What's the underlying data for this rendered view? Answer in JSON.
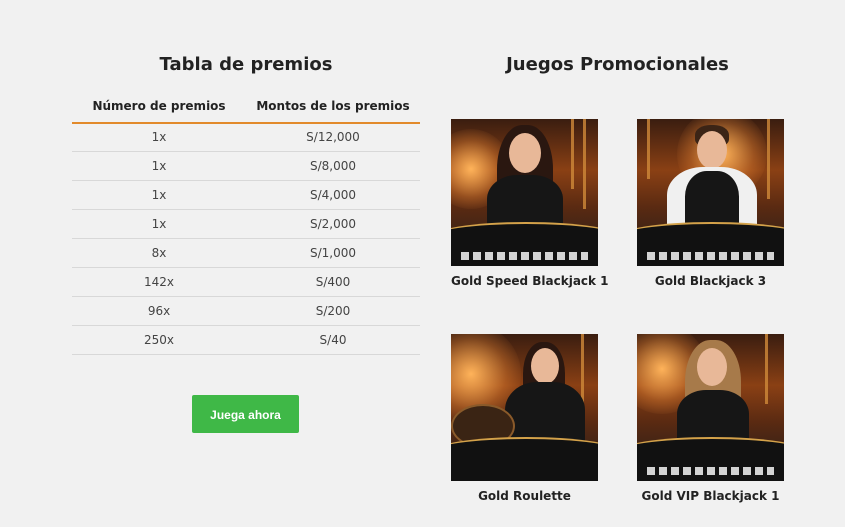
{
  "prize_table": {
    "title": "Tabla de premios",
    "columns": [
      "Número de premios",
      "Montos de los premios"
    ],
    "rows": [
      [
        "1x",
        "S/12,000"
      ],
      [
        "1x",
        "S/8,000"
      ],
      [
        "1x",
        "S/4,000"
      ],
      [
        "1x",
        "S/2,000"
      ],
      [
        "8x",
        "S/1,000"
      ],
      [
        "142x",
        "S/400"
      ],
      [
        "96x",
        "S/200"
      ],
      [
        "250x",
        "S/40"
      ]
    ],
    "accent_color": "#e28a2b"
  },
  "cta": {
    "label": "Juega ahora",
    "color": "#3fb847"
  },
  "promo": {
    "title": "Juegos Promocionales",
    "games": [
      {
        "name": "Gold Speed Blackjack 1",
        "icon": "dealer-thumbnail"
      },
      {
        "name": "Gold Blackjack 3",
        "icon": "dealer-thumbnail"
      },
      {
        "name": "Gold Roulette",
        "icon": "dealer-thumbnail"
      },
      {
        "name": "Gold VIP Blackjack 1",
        "icon": "dealer-thumbnail"
      }
    ]
  }
}
